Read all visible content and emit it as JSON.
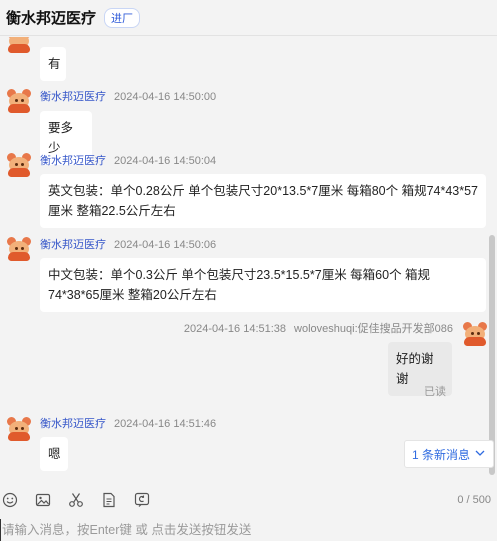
{
  "header": {
    "title": "衡水邦迈医疗",
    "tag": "进厂"
  },
  "messages": [
    {
      "text": "有"
    },
    {
      "sender": "衡水邦迈医疗",
      "time": "2024-04-16 14:50:00",
      "text": "要多少"
    },
    {
      "sender": "衡水邦迈医疗",
      "time": "2024-04-16 14:50:04",
      "text": "英文包装：单个0.28公斤 单个包装尺寸20*13.5*7厘米 每箱80个 箱规74*43*57厘米   整箱22.5公斤左右"
    },
    {
      "sender": "衡水邦迈医疗",
      "time": "2024-04-16 14:50:06",
      "text": "中文包装：单个0.3公斤 单个包装尺寸23.5*15.5*7厘米 每箱60个  箱规74*38*65厘米  整箱20公斤左右"
    },
    {
      "sender": "woloveshuqi:促佳搜品开发部086",
      "time": "2024-04-16 14:51:38",
      "text": "好的谢谢",
      "status": "已读"
    },
    {
      "sender": "衡水邦迈医疗",
      "time": "2024-04-16 14:51:46",
      "text": "嗯"
    }
  ],
  "new_messages_label": "1 条新消息",
  "toolbar": {
    "icons": [
      "emoji-icon",
      "image-icon",
      "scissors-icon",
      "document-icon",
      "history-icon"
    ],
    "counter": "0 / 500"
  },
  "input": {
    "placeholder": "请输入消息，按Enter键 或 点击发送按钮发送"
  },
  "colors": {
    "sender": "#3556c9",
    "link": "#2f6be0",
    "avatar": "#e05a2c"
  }
}
